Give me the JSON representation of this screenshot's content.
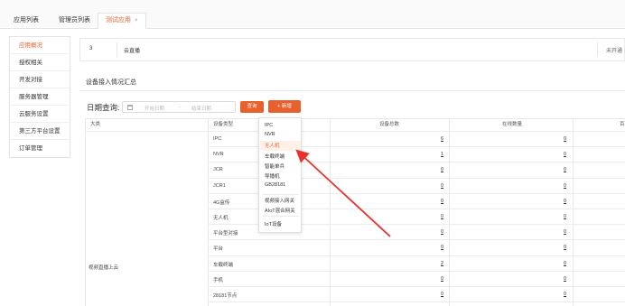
{
  "tabs": [
    {
      "label": "应用列表"
    },
    {
      "label": "管理员列表"
    },
    {
      "label": "测试应用",
      "close": "×"
    }
  ],
  "sidebar": {
    "items": [
      {
        "label": "应用概况"
      },
      {
        "label": "授权相关"
      },
      {
        "label": "开发对接"
      },
      {
        "label": "服务器管理"
      },
      {
        "label": "云服务设置"
      },
      {
        "label": "第三方平台设置"
      },
      {
        "label": "订单管理"
      }
    ]
  },
  "top_row": {
    "c1": "3",
    "c2": "云直播",
    "c3": "未开通"
  },
  "section_title": "设备接入情况汇总",
  "filter": {
    "date_label": "日期查询:",
    "start_placeholder": "开始日期",
    "separator": "-",
    "end_placeholder": "结束日期",
    "query_label": "查询",
    "add_label": "+ 新增"
  },
  "table": {
    "headers": [
      "大类",
      "设备类型",
      "设备总数",
      "在线数量",
      "百"
    ],
    "category": "视频直播上云",
    "rows": [
      {
        "type": "IPC",
        "total": "6",
        "online": "0"
      },
      {
        "type": "NVR",
        "total": "1",
        "online": "0"
      },
      {
        "type": "JCR",
        "total": "0",
        "online": "0"
      },
      {
        "type": "JCR1",
        "total": "0",
        "online": "0"
      },
      {
        "type": "4G盒传",
        "total": "0",
        "online": "0"
      },
      {
        "type": "无人机",
        "total": "0",
        "online": "0"
      },
      {
        "type": "平台型对接",
        "total": "0",
        "online": "0"
      },
      {
        "type": "平台",
        "total": "0",
        "online": "0"
      },
      {
        "type": "车载终端",
        "total": "2",
        "online": "0"
      },
      {
        "type": "手机",
        "total": "0",
        "online": "0"
      },
      {
        "type": "28181节点",
        "total": "0",
        "online": "0"
      }
    ]
  },
  "dropdown": {
    "items": [
      "IPC",
      "NVR",
      "无人机",
      "车载终端",
      "智能单兵",
      "导播机",
      "GB28181",
      "视频接入网关",
      "AIoT混合网关",
      "IoT设备"
    ],
    "highlighted": "无人机"
  },
  "colors": {
    "accent": "#e8612c",
    "arrow": "#e8312c"
  }
}
